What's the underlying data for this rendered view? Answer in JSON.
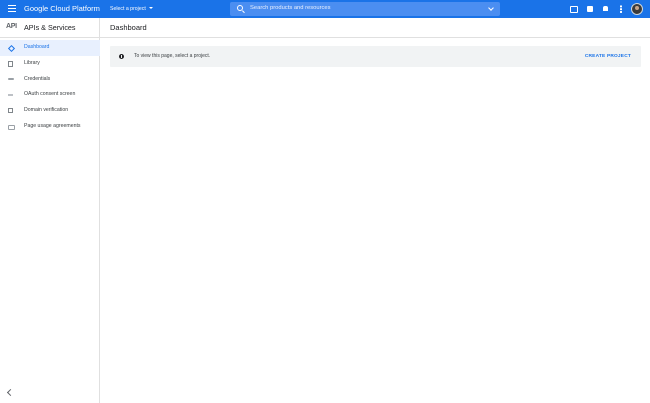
{
  "header": {
    "brand": "Google Cloud Platform",
    "project_selector": "Select a project",
    "search_placeholder": "Search products and resources",
    "accent_color": "#1a73e8",
    "icons": [
      "menu-icon",
      "terminal-icon",
      "gift-icon",
      "bell-icon",
      "more-vert-icon",
      "avatar"
    ]
  },
  "sidebar": {
    "logo": "API",
    "title": "APIs & Services",
    "items": [
      {
        "label": "Dashboard",
        "icon": "dashboard-icon",
        "active": true
      },
      {
        "label": "Library",
        "icon": "library-icon",
        "active": false
      },
      {
        "label": "Credentials",
        "icon": "key-icon",
        "active": false
      },
      {
        "label": "OAuth consent screen",
        "icon": "consent-icon",
        "active": false
      },
      {
        "label": "Domain verification",
        "icon": "checkbox-icon",
        "active": false
      },
      {
        "label": "Page usage agreements",
        "icon": "settings-icon",
        "active": false
      }
    ]
  },
  "main": {
    "title": "Dashboard",
    "banner": {
      "message": "To view this page, select a project.",
      "action": "CREATE PROJECT"
    }
  }
}
